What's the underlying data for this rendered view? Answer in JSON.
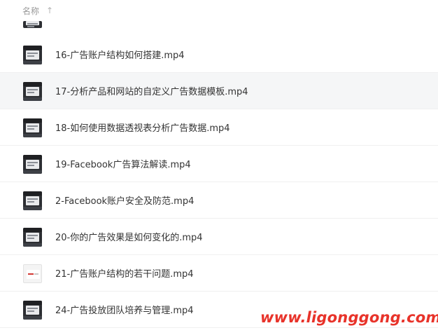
{
  "header": {
    "name_label": "名称",
    "sort_icon": "arrow-up-icon"
  },
  "files": [
    {
      "name": "16-广告账户结构如何搭建.mp4",
      "thumb": "dark"
    },
    {
      "name": "17-分析产品和网站的自定义广告数据模板.mp4",
      "thumb": "dark"
    },
    {
      "name": "18-如何使用数据透视表分析广告数据.mp4",
      "thumb": "dark"
    },
    {
      "name": "19-Facebook广告算法解读.mp4",
      "thumb": "dark"
    },
    {
      "name": "2-Facebook账户安全及防范.mp4",
      "thumb": "dark"
    },
    {
      "name": "20-你的广告效果是如何变化的.mp4",
      "thumb": "dark"
    },
    {
      "name": "21-广告账户结构的若干问题.mp4",
      "thumb": "light"
    },
    {
      "name": "24-广告投放团队培养与管理.mp4",
      "thumb": "dark"
    }
  ],
  "watermark": "www.ligonggong.com",
  "colors": {
    "watermark": "#e8332a",
    "hover_row": "#f5f6f7"
  }
}
